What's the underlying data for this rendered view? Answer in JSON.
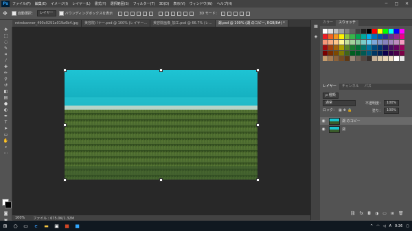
{
  "app": {
    "logo": "Ps"
  },
  "menu": [
    "ファイル(F)",
    "編集(E)",
    "イメージ(I)",
    "レイヤー(L)",
    "書式(Y)",
    "選択範囲(S)",
    "フィルター(T)",
    "3D(D)",
    "表示(V)",
    "ウィンドウ(W)",
    "ヘルプ(H)"
  ],
  "window_controls": {
    "minimize": "─",
    "maximize": "□",
    "close": "✕"
  },
  "options": {
    "auto_select_label": "自動選択：",
    "auto_select_value": "レイヤー",
    "bbox_label": "バウンディングボックスを表示",
    "mode_3d_label": "3D モード："
  },
  "tabs": [
    {
      "label": "retrobanner_490x0291a019a6b4.jpg"
    },
    {
      "label": "美容院バナー.psd @ 100% (レイヤー..."
    },
    {
      "label": "美容院画像_加工.psd @ 66.7% (レ..."
    },
    {
      "label": "湖.psd @ 100% (湖 のコピー, RGB/8#) *"
    }
  ],
  "status": {
    "zoom": "100%",
    "file_info": "ファイル : 675.0K/1.32M"
  },
  "panels": {
    "color_tab": "カラー",
    "swatch_tab": "スウォッチ",
    "layers_tab": "レイヤー",
    "channels_tab": "チャンネル",
    "paths_tab": "パス",
    "kind_label": "ρ 種類",
    "blend_mode": "通常",
    "opacity_label": "不透明度：",
    "opacity_value": "100%",
    "lock_label": "ロック：",
    "fill_label": "塗り：",
    "fill_value": "100%",
    "layers": [
      {
        "name": "湖 のコピー"
      },
      {
        "name": "湖"
      }
    ]
  },
  "taskbar": {
    "time": "0:36",
    "ime": "A"
  },
  "colors": {
    "swatches": [
      [
        "#ffffff",
        "#e0e0e0",
        "#c0c0c0",
        "#a0a0a0",
        "#808080",
        "#606060",
        "#404040",
        "#202020",
        "#000000",
        "#ff0000",
        "#ffff00",
        "#00ff00",
        "#00ffff",
        "#0000ff",
        "#ff00ff"
      ],
      [
        "#ed1c24",
        "#f26522",
        "#f7941d",
        "#fff200",
        "#8dc63f",
        "#39b54a",
        "#00a651",
        "#00a99d",
        "#00aeef",
        "#0072bc",
        "#0054a6",
        "#2e3192",
        "#662d91",
        "#92278f",
        "#ec008c"
      ],
      [
        "#f69679",
        "#f9ad81",
        "#fdc68a",
        "#fff799",
        "#c4df9b",
        "#a3d39c",
        "#82ca9c",
        "#7accc8",
        "#6dcff6",
        "#7da7d9",
        "#8393ca",
        "#8781bd",
        "#a186be",
        "#bd8cbf",
        "#f49ac1"
      ],
      [
        "#9e0b0f",
        "#a0410d",
        "#a3620a",
        "#aba000",
        "#598527",
        "#197b30",
        "#007236",
        "#00746b",
        "#0076a3",
        "#004a80",
        "#003471",
        "#1b1464",
        "#440e62",
        "#630460",
        "#9e005d"
      ],
      [
        "#790000",
        "#7b2e00",
        "#7d4900",
        "#827b00",
        "#406618",
        "#005e20",
        "#005826",
        "#005952",
        "#005b7f",
        "#003663",
        "#002157",
        "#0d004c",
        "#32004b",
        "#4b0049",
        "#7b0046"
      ],
      [
        "#c69c6d",
        "#a67c52",
        "#8c6239",
        "#754c24",
        "#603913",
        "#998675",
        "#736357",
        "#534741",
        "#362f2d",
        "#c7b299",
        "#d9c7a8",
        "#e6d5b8",
        "#f0e2c8",
        "#ffffff",
        "#e6e6e6"
      ]
    ]
  }
}
